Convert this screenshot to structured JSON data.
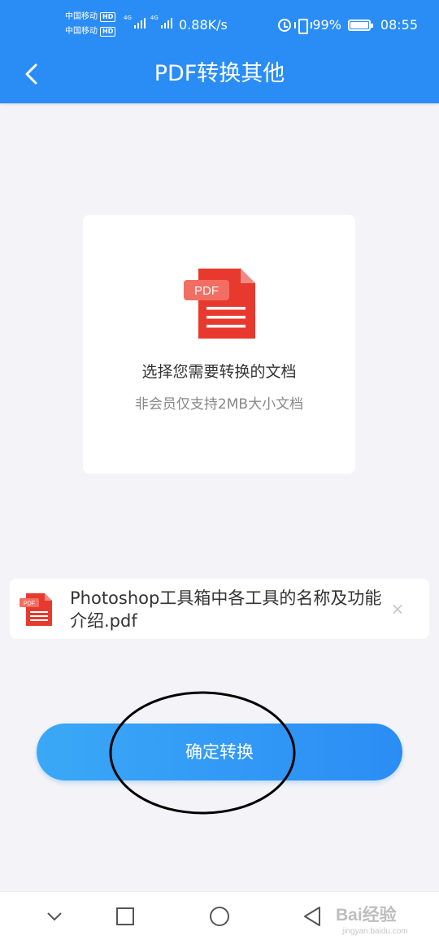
{
  "status_bar": {
    "carrier1": "中国移动",
    "carrier2": "中国移动",
    "hd_badge": "HD",
    "network": "4G",
    "net_speed": "0.88K/s",
    "battery": "99%",
    "time": "08:55",
    "icons": [
      "alarm-icon",
      "vibrate-icon",
      "battery-icon"
    ]
  },
  "header": {
    "title": "PDF转换其他",
    "back_icon": "chevron-left-icon",
    "background_color": "#2a8df5"
  },
  "upload_card": {
    "icon": "pdf-file-icon",
    "icon_label": "PDF",
    "title": "选择您需要转换的文档",
    "subtitle": "非会员仅支持2MB大小文档"
  },
  "selected_file": {
    "icon": "pdf-file-icon",
    "icon_label": "PDF",
    "name": "Photoshop工具箱中各工具的名称及功能介绍.pdf",
    "remove_icon": "close-icon",
    "remove_glyph": "×"
  },
  "confirm_button": {
    "label": "确定转换",
    "color": "#2a8df5"
  },
  "system_nav": {
    "items": [
      "chevron-down-icon",
      "square-recent-icon",
      "circle-home-icon",
      "triangle-back-icon"
    ]
  },
  "watermark": {
    "text": "Bai经验",
    "sub": "jingyan.baidu.com"
  }
}
